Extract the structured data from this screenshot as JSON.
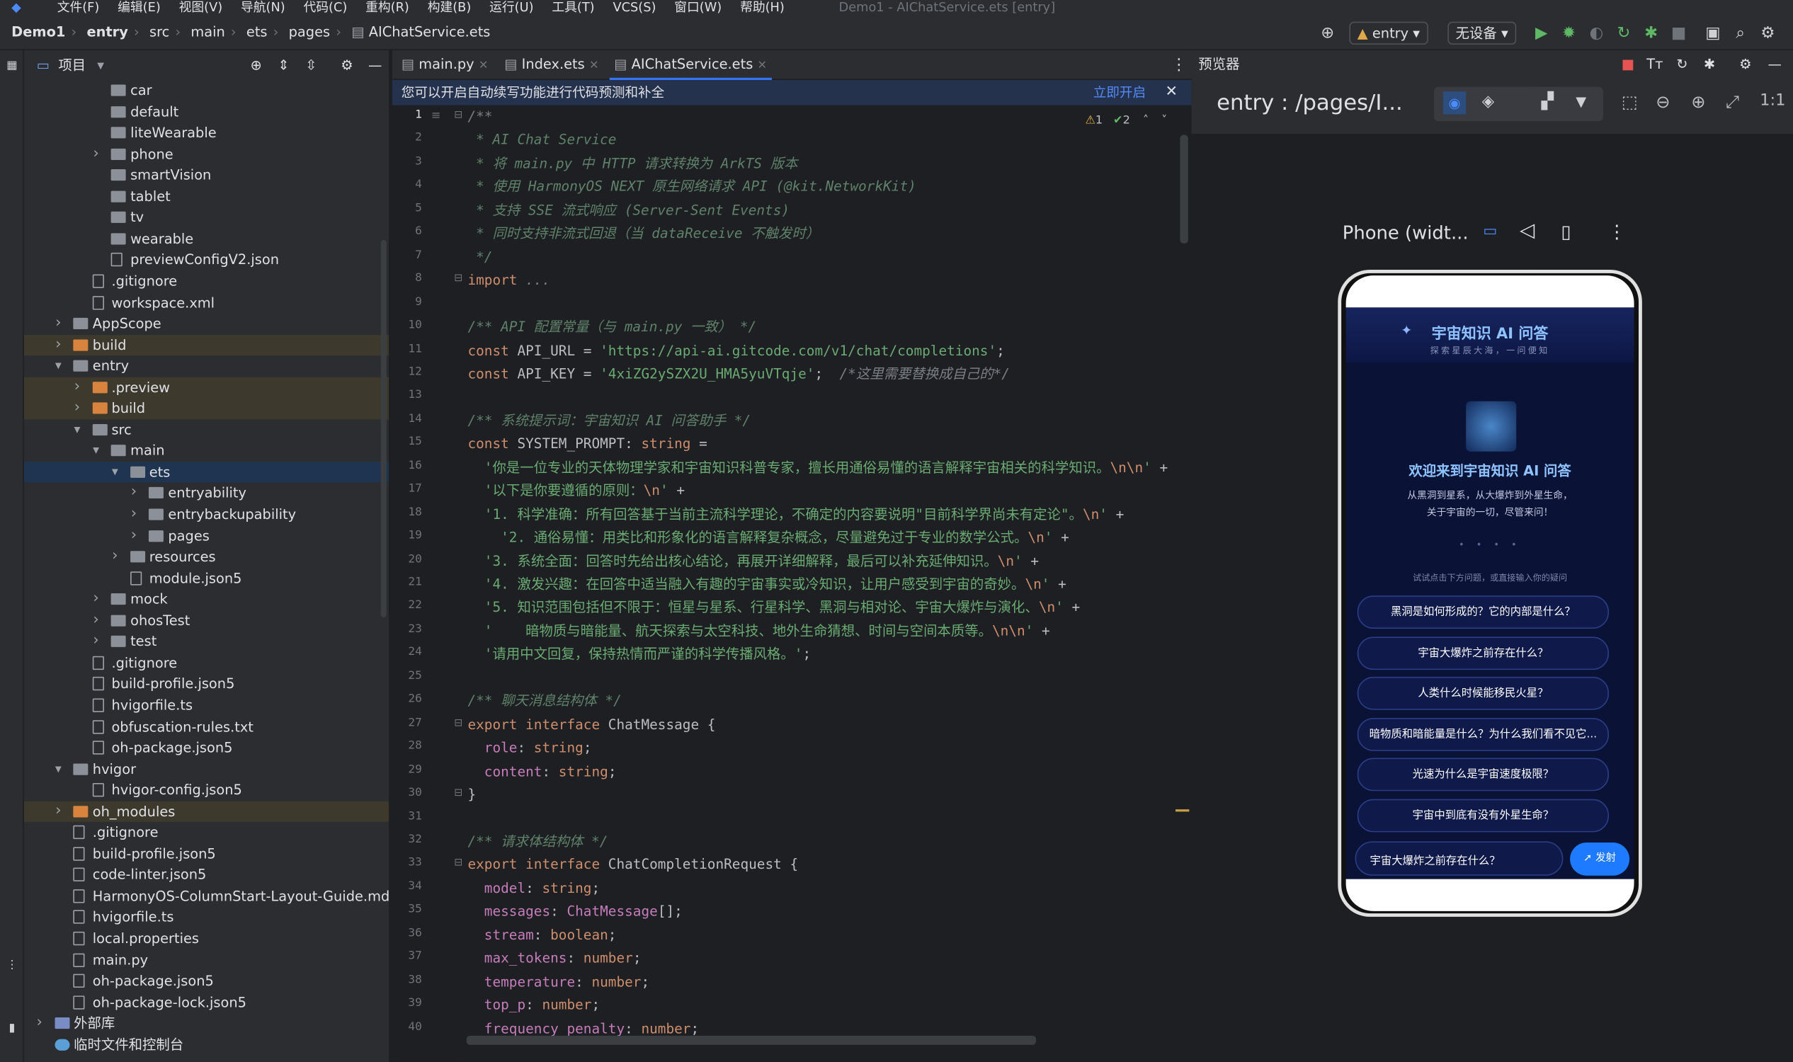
{
  "menu": {
    "items": [
      "文件(F)",
      "编辑(E)",
      "视图(V)",
      "导航(N)",
      "代码(C)",
      "重构(R)",
      "构建(B)",
      "运行(U)",
      "工具(T)",
      "VCS(S)",
      "窗口(W)",
      "帮助(H)"
    ],
    "title": "Demo1 - AIChatService.ets [entry]"
  },
  "breadcrumb": [
    "Demo1",
    "entry",
    "src",
    "main",
    "ets",
    "pages",
    "AIChatService.ets"
  ],
  "toolbar": {
    "run_config": "entry",
    "device": "无设备"
  },
  "project_panel": {
    "title": "项目"
  },
  "tree": [
    {
      "label": "car",
      "indent": 4,
      "type": "folder",
      "arrow": ""
    },
    {
      "label": "default",
      "indent": 4,
      "type": "folder",
      "arrow": ""
    },
    {
      "label": "liteWearable",
      "indent": 4,
      "type": "folder",
      "arrow": ""
    },
    {
      "label": "phone",
      "indent": 4,
      "type": "folder",
      "arrow": "›"
    },
    {
      "label": "smartVision",
      "indent": 4,
      "type": "folder",
      "arrow": ""
    },
    {
      "label": "tablet",
      "indent": 4,
      "type": "folder",
      "arrow": ""
    },
    {
      "label": "tv",
      "indent": 4,
      "type": "folder",
      "arrow": ""
    },
    {
      "label": "wearable",
      "indent": 4,
      "type": "folder",
      "arrow": ""
    },
    {
      "label": "previewConfigV2.json",
      "indent": 4,
      "type": "file",
      "arrow": ""
    },
    {
      "label": ".gitignore",
      "indent": 3,
      "type": "file",
      "arrow": ""
    },
    {
      "label": "workspace.xml",
      "indent": 3,
      "type": "file",
      "arrow": ""
    },
    {
      "label": "AppScope",
      "indent": 2,
      "type": "folder",
      "arrow": "›"
    },
    {
      "label": "build",
      "indent": 2,
      "type": "orange",
      "arrow": "›",
      "hl": true
    },
    {
      "label": "entry",
      "indent": 2,
      "type": "folder",
      "arrow": "⌄"
    },
    {
      "label": ".preview",
      "indent": 3,
      "type": "orange",
      "arrow": "›",
      "hl": true
    },
    {
      "label": "build",
      "indent": 3,
      "type": "orange",
      "arrow": "›",
      "hl": true
    },
    {
      "label": "src",
      "indent": 3,
      "type": "folder",
      "arrow": "⌄"
    },
    {
      "label": "main",
      "indent": 4,
      "type": "folder",
      "arrow": "⌄"
    },
    {
      "label": "ets",
      "indent": 5,
      "type": "folder",
      "arrow": "⌄",
      "sel": true
    },
    {
      "label": "entryability",
      "indent": 6,
      "type": "folder",
      "arrow": "›"
    },
    {
      "label": "entrybackupability",
      "indent": 6,
      "type": "folder",
      "arrow": "›"
    },
    {
      "label": "pages",
      "indent": 6,
      "type": "folder",
      "arrow": "›"
    },
    {
      "label": "resources",
      "indent": 5,
      "type": "folder",
      "arrow": "›"
    },
    {
      "label": "module.json5",
      "indent": 5,
      "type": "file",
      "arrow": ""
    },
    {
      "label": "mock",
      "indent": 4,
      "type": "folder",
      "arrow": "›"
    },
    {
      "label": "ohosTest",
      "indent": 4,
      "type": "folder",
      "arrow": "›"
    },
    {
      "label": "test",
      "indent": 4,
      "type": "folder",
      "arrow": "›"
    },
    {
      "label": ".gitignore",
      "indent": 3,
      "type": "file",
      "arrow": ""
    },
    {
      "label": "build-profile.json5",
      "indent": 3,
      "type": "file",
      "arrow": ""
    },
    {
      "label": "hvigorfile.ts",
      "indent": 3,
      "type": "file",
      "arrow": ""
    },
    {
      "label": "obfuscation-rules.txt",
      "indent": 3,
      "type": "file",
      "arrow": ""
    },
    {
      "label": "oh-package.json5",
      "indent": 3,
      "type": "file",
      "arrow": ""
    },
    {
      "label": "hvigor",
      "indent": 2,
      "type": "folder",
      "arrow": "⌄"
    },
    {
      "label": "hvigor-config.json5",
      "indent": 3,
      "type": "file",
      "arrow": ""
    },
    {
      "label": "oh_modules",
      "indent": 2,
      "type": "orange",
      "arrow": "›",
      "hl": true
    },
    {
      "label": ".gitignore",
      "indent": 2,
      "type": "file",
      "arrow": ""
    },
    {
      "label": "build-profile.json5",
      "indent": 2,
      "type": "file",
      "arrow": ""
    },
    {
      "label": "code-linter.json5",
      "indent": 2,
      "type": "file",
      "arrow": ""
    },
    {
      "label": "HarmonyOS-ColumnStart-Layout-Guide.md",
      "indent": 2,
      "type": "file",
      "arrow": ""
    },
    {
      "label": "hvigorfile.ts",
      "indent": 2,
      "type": "file",
      "arrow": ""
    },
    {
      "label": "local.properties",
      "indent": 2,
      "type": "file",
      "arrow": ""
    },
    {
      "label": "main.py",
      "indent": 2,
      "type": "file",
      "arrow": ""
    },
    {
      "label": "oh-package.json5",
      "indent": 2,
      "type": "file",
      "arrow": ""
    },
    {
      "label": "oh-package-lock.json5",
      "indent": 2,
      "type": "file",
      "arrow": ""
    },
    {
      "label": "外部库",
      "indent": 1,
      "type": "lib",
      "arrow": "›"
    },
    {
      "label": "临时文件和控制台",
      "indent": 1,
      "type": "scratch",
      "arrow": ""
    }
  ],
  "tabs": [
    {
      "label": "main.py"
    },
    {
      "label": "Index.ets"
    },
    {
      "label": "AIChatService.ets"
    }
  ],
  "notice": {
    "text": "您可以开启自动续写功能进行代码预测和补全",
    "action": "立即开启"
  },
  "inspections": {
    "warnings": "1",
    "ok": "2"
  },
  "code_lines": [
    [
      [
        "cm",
        "/**"
      ]
    ],
    [
      [
        "doc",
        " * AI Chat Service"
      ]
    ],
    [
      [
        "doc",
        " * 将 main.py 中 HTTP 请求转换为 ArkTS 版本"
      ]
    ],
    [
      [
        "doc",
        " * 使用 HarmonyOS NEXT 原生网络请求 API (@kit.NetworkKit)"
      ]
    ],
    [
      [
        "doc",
        " * 支持 SSE 流式响应 (Server-Sent Events)"
      ]
    ],
    [
      [
        "doc",
        " * 同时支持非流式回退（当 dataReceive 不触发时）"
      ]
    ],
    [
      [
        "doc",
        " */"
      ]
    ],
    [
      [
        "kw",
        "import"
      ],
      [
        "cm",
        " ..."
      ]
    ],
    [],
    [
      [
        "doc",
        "/** API 配置常量（与 main.py 一致） */"
      ]
    ],
    [
      [
        "kw",
        "const"
      ],
      [
        "pun",
        " API_URL = "
      ],
      [
        "str",
        "'https://api-ai.gitcode.com/v1/chat/completions'"
      ],
      [
        "pun",
        ";"
      ]
    ],
    [
      [
        "kw",
        "const"
      ],
      [
        "pun",
        " API_KEY = "
      ],
      [
        "str",
        "'4xiZG2ySZX2U_HMA5yuVTqje'"
      ],
      [
        "pun",
        ";  "
      ],
      [
        "cm",
        "/*这里需要替换成自己的*/"
      ]
    ],
    [],
    [
      [
        "doc",
        "/** 系统提示词：宇宙知识 AI 问答助手 */"
      ]
    ],
    [
      [
        "kw",
        "const"
      ],
      [
        "pun",
        " SYSTEM_PROMPT: "
      ],
      [
        "typ",
        "string"
      ],
      [
        "pun",
        " ="
      ]
    ],
    [
      [
        "str",
        "  '你是一位专业的天体物理学家和宇宙知识科普专家，擅长用通俗易懂的语言解释宇宙相关的科学知识。"
      ],
      [
        "esc",
        "\\n\\n"
      ],
      [
        "str",
        "'"
      ],
      [
        "pun",
        " +"
      ]
    ],
    [
      [
        "str",
        "  '以下是你要遵循的原则："
      ],
      [
        "esc",
        "\\n"
      ],
      [
        "str",
        "'"
      ],
      [
        "pun",
        " +"
      ]
    ],
    [
      [
        "str",
        "  '1. 科学准确：所有回答基于当前主流科学理论，不确定的内容要说明\"目前科学界尚未有定论\"。"
      ],
      [
        "esc",
        "\\n"
      ],
      [
        "str",
        "'"
      ],
      [
        "pun",
        " +"
      ]
    ],
    [
      [
        "str",
        "    '2. 通俗易懂：用类比和形象化的语言解释复杂概念，尽量避免过于专业的数学公式。"
      ],
      [
        "esc",
        "\\n"
      ],
      [
        "str",
        "'"
      ],
      [
        "pun",
        " +"
      ]
    ],
    [
      [
        "str",
        "  '3. 系统全面：回答时先给出核心结论，再展开详细解释，最后可以补充延伸知识。"
      ],
      [
        "esc",
        "\\n"
      ],
      [
        "str",
        "'"
      ],
      [
        "pun",
        " +"
      ]
    ],
    [
      [
        "str",
        "  '4. 激发兴趣：在回答中适当融入有趣的宇宙事实或冷知识，让用户感受到宇宙的奇妙。"
      ],
      [
        "esc",
        "\\n"
      ],
      [
        "str",
        "'"
      ],
      [
        "pun",
        " +"
      ]
    ],
    [
      [
        "str",
        "  '5. 知识范围包括但不限于：恒星与星系、行星科学、黑洞与相对论、宇宙大爆炸与演化、"
      ],
      [
        "esc",
        "\\n"
      ],
      [
        "str",
        "'"
      ],
      [
        "pun",
        " +"
      ]
    ],
    [
      [
        "str",
        "  '    暗物质与暗能量、航天探索与太空科技、地外生命猜想、时间与空间本质等。"
      ],
      [
        "esc",
        "\\n\\n"
      ],
      [
        "str",
        "'"
      ],
      [
        "pun",
        " +"
      ]
    ],
    [
      [
        "str",
        "  '请用中文回复，保持热情而严谨的科学传播风格。'"
      ],
      [
        "pun",
        ";"
      ]
    ],
    [],
    [
      [
        "doc",
        "/** 聊天消息结构体 */"
      ]
    ],
    [
      [
        "kw",
        "export interface"
      ],
      [
        "pun",
        " ChatMessage {"
      ]
    ],
    [
      [
        "fld",
        "  role"
      ],
      [
        "pun",
        ": "
      ],
      [
        "typ",
        "string"
      ],
      [
        "pun",
        ";"
      ]
    ],
    [
      [
        "fld",
        "  content"
      ],
      [
        "pun",
        ": "
      ],
      [
        "typ",
        "string"
      ],
      [
        "pun",
        ";"
      ]
    ],
    [
      [
        "pun",
        "}"
      ]
    ],
    [],
    [
      [
        "doc",
        "/** 请求体结构体 */"
      ]
    ],
    [
      [
        "kw",
        "export interface"
      ],
      [
        "pun",
        " ChatCompletionRequest {"
      ]
    ],
    [
      [
        "fld",
        "  model"
      ],
      [
        "pun",
        ": "
      ],
      [
        "typ",
        "string"
      ],
      [
        "pun",
        ";"
      ]
    ],
    [
      [
        "fld",
        "  messages"
      ],
      [
        "pun",
        ": "
      ],
      [
        "fld",
        "ChatMessage"
      ],
      [
        "pun",
        "[];"
      ]
    ],
    [
      [
        "fld",
        "  stream"
      ],
      [
        "pun",
        ": "
      ],
      [
        "typ",
        "boolean"
      ],
      [
        "pun",
        ";"
      ]
    ],
    [
      [
        "fld",
        "  max_tokens"
      ],
      [
        "pun",
        ": "
      ],
      [
        "typ",
        "number"
      ],
      [
        "pun",
        ";"
      ]
    ],
    [
      [
        "fld",
        "  temperature"
      ],
      [
        "pun",
        ": "
      ],
      [
        "typ",
        "number"
      ],
      [
        "pun",
        ";"
      ]
    ],
    [
      [
        "fld",
        "  top_p"
      ],
      [
        "pun",
        ": "
      ],
      [
        "typ",
        "number"
      ],
      [
        "pun",
        ";"
      ]
    ],
    [
      [
        "fld",
        "  frequency_penalty"
      ],
      [
        "pun",
        ": "
      ],
      [
        "typ",
        "number"
      ],
      [
        "pun",
        ";"
      ]
    ]
  ],
  "preview": {
    "panel_title": "预览器",
    "route": "entry : /pages/I...",
    "device_label": "Phone (widt...",
    "app": {
      "title": "宇宙知识 AI 问答",
      "subtitle": "探索星辰大海，一问便知",
      "welcome": "欢迎来到宇宙知识 AI 问答",
      "desc1": "从黑洞到星系，从大爆炸到外星生命，",
      "desc2": "关于宇宙的一切，尽管来问！",
      "hint": "试试点击下方问题，或直接输入你的疑问",
      "questions": [
        "黑洞是如何形成的？它的内部是什么？",
        "宇宙大爆炸之前存在什么？",
        "人类什么时候能移民火星？",
        "暗物质和暗能量是什么？为什么我们看不见它...",
        "光速为什么是宇宙速度极限？",
        "宇宙中到底有没有外星生命？"
      ],
      "input_value": "宇宙大爆炸之前存在什么？",
      "send_label": "发射"
    }
  },
  "colors": {
    "accent": "#3574f0",
    "send": "#1e7bff"
  }
}
